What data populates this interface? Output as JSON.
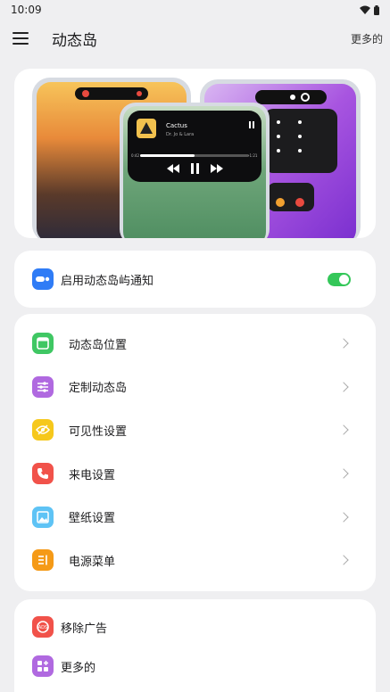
{
  "status_bar": {
    "time": "10:09"
  },
  "app_bar": {
    "title": "动态岛",
    "more_label": "更多的"
  },
  "hero": {
    "song_title": "Cactus",
    "song_artist": "Dr. Jo & Lara",
    "time_elapsed": "0:42",
    "time_remaining": "-1:21",
    "progress": 0.5
  },
  "toggle": {
    "label": "启用动态岛屿通知",
    "enabled": true
  },
  "menu": {
    "items": [
      {
        "label": "动态岛位置",
        "icon": "window-icon",
        "color": "#3fc763"
      },
      {
        "label": "定制动态岛",
        "icon": "sliders-icon",
        "color": "#b069e0"
      },
      {
        "label": "可见性设置",
        "icon": "eye-off-icon",
        "color": "#f6c81c"
      },
      {
        "label": "来电设置",
        "icon": "phone-icon",
        "color": "#f1524a"
      },
      {
        "label": "壁纸设置",
        "icon": "image-icon",
        "color": "#5ec3f5"
      },
      {
        "label": "电源菜单",
        "icon": "power-menu-icon",
        "color": "#f59a17"
      }
    ]
  },
  "extra": {
    "items": [
      {
        "label": "移除广告",
        "icon": "ad-block-icon",
        "color": "#f1524a"
      },
      {
        "label": "更多的",
        "icon": "grid-plus-icon",
        "color": "#b069e0"
      }
    ]
  }
}
